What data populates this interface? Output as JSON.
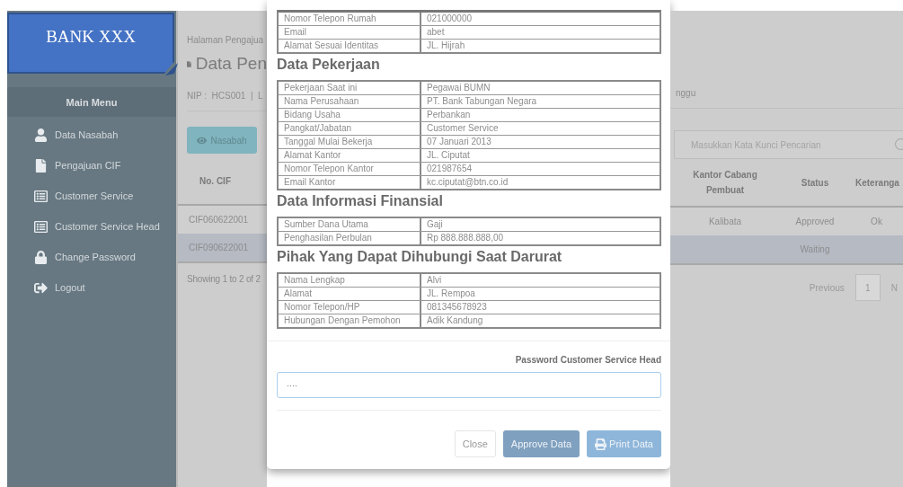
{
  "logo": {
    "text": "BANK XXX"
  },
  "sidebar": {
    "title": "Main Menu",
    "items": [
      {
        "label": "Data Nasabah"
      },
      {
        "label": "Pengajuan CIF"
      },
      {
        "label": "Customer Service"
      },
      {
        "label": "Customer Service Head"
      },
      {
        "label": "Change Password"
      },
      {
        "label": "Logout"
      }
    ]
  },
  "page": {
    "breadcrumb": "Halaman Pengajua",
    "title": "Data Pen",
    "user_info": "NIP :  HCS001  |  L",
    "user_info_end": "nggu",
    "view_button": "Nasabah",
    "search": {
      "placeholder": "Masukkan Kata Kunci Pencarian"
    },
    "table": {
      "first_column": "No. CIF",
      "columns": [
        "Kantor Cabang Pembuat",
        "Status",
        "Keteranga"
      ],
      "rows": [
        {
          "cif": "CIF060622001",
          "cells": [
            "Kalibata",
            "Approved",
            "Ok"
          ],
          "selected": false
        },
        {
          "cif": "CIF090622001",
          "cells": [
            "",
            "Waiting",
            ""
          ],
          "selected": true
        }
      ]
    },
    "footer": "Showing 1 to 2 of 2",
    "pagination": {
      "previous": "Previous",
      "page": "1",
      "next": "N"
    }
  },
  "modal": {
    "sections": [
      {
        "rows": [
          [
            "Nomor Telepon Rumah",
            "021000000"
          ],
          [
            "Email",
            "abet"
          ],
          [
            "Alamat Sesuai Identitas",
            "JL. Hijrah"
          ]
        ]
      },
      {
        "heading": "Data Pekerjaan",
        "rows": [
          [
            "Pekerjaan Saat ini",
            "Pegawai BUMN"
          ],
          [
            "Nama Perusahaan",
            "PT. Bank Tabungan Negara"
          ],
          [
            "Bidang Usaha",
            "Perbankan"
          ],
          [
            "Pangkat/Jabatan",
            "Customer Service"
          ],
          [
            "Tanggal Mulai Bekerja",
            "07 Januari 2013"
          ],
          [
            "Alamat Kantor",
            "JL. Ciputat"
          ],
          [
            "Nomor Telepon Kantor",
            "021987654"
          ],
          [
            "Email Kantor",
            "kc.ciputat@btn.co.id"
          ]
        ]
      },
      {
        "heading": "Data Informasi Finansial",
        "rows": [
          [
            "Sumber Dana Utama",
            "Gaji"
          ],
          [
            "Penghasilan Perbulan",
            "Rp 888.888.888,00"
          ]
        ]
      },
      {
        "heading": "Pihak Yang Dapat Dihubungi Saat Darurat",
        "rows": [
          [
            "Nama Lengkap",
            "Alvi"
          ],
          [
            "Alamat",
            "JL. Rempoa"
          ],
          [
            "Nomor Telepon/HP",
            "081345678923"
          ],
          [
            "Hubungan Dengan Pemohon",
            "Adik Kandung"
          ]
        ]
      }
    ],
    "password_label": "Password Customer Service Head",
    "password_value": "····",
    "buttons": [
      {
        "label": "Close",
        "kind": "default"
      },
      {
        "label": "Approve Data",
        "kind": "primary"
      },
      {
        "label": "Print Data",
        "kind": "print"
      }
    ]
  }
}
